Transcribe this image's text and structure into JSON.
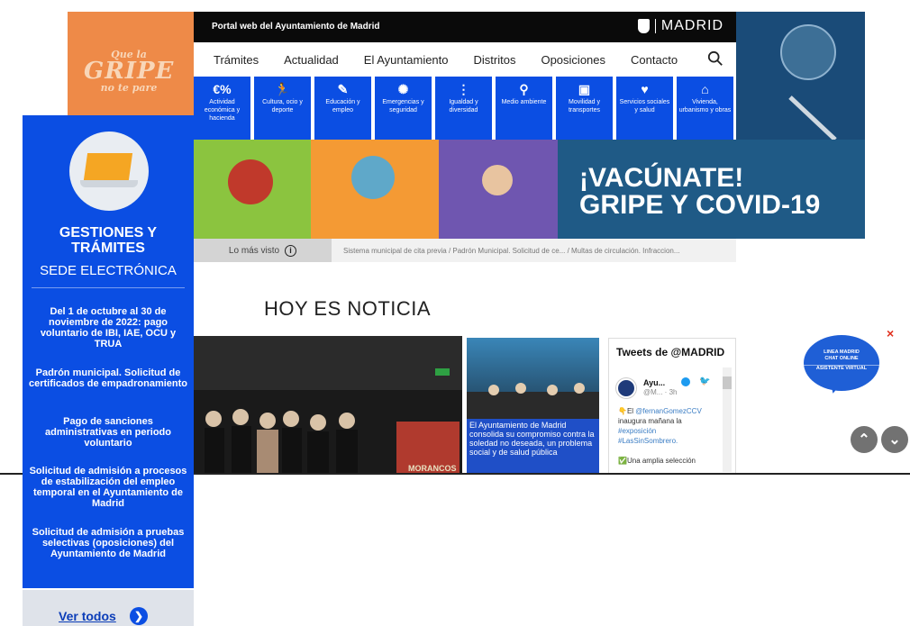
{
  "header": {
    "portal_label": "Portal web del Ayuntamiento de Madrid",
    "logo_text": "MADRID"
  },
  "nav": {
    "items": [
      "Trámites",
      "Actualidad",
      "El Ayuntamiento",
      "Distritos",
      "Oposiciones",
      "Contacto"
    ],
    "search_icon": "search-icon"
  },
  "categories": [
    {
      "icon": "€%",
      "label": "Actividad económica y hacienda"
    },
    {
      "icon": "🏃",
      "label": "Cultura, ocio y deporte"
    },
    {
      "icon": "✎",
      "label": "Educación y empleo"
    },
    {
      "icon": "✺",
      "label": "Emergencias y seguridad"
    },
    {
      "icon": "⋮",
      "label": "Igualdad y diversidad"
    },
    {
      "icon": "⚲",
      "label": "Medio ambiente"
    },
    {
      "icon": "▣",
      "label": "Movilidad y transportes"
    },
    {
      "icon": "♥",
      "label": "Servicios sociales y salud"
    },
    {
      "icon": "⌂",
      "label": "Vivienda, urbanismo y obras"
    }
  ],
  "campaign": {
    "gripe_top": "Que la",
    "gripe_big": "GRIPE",
    "gripe_bottom": "no te pare",
    "vacunate_l1": "¡VACÚNATE!",
    "vacunate_l2": "GRIPE Y COVID-19"
  },
  "mas_visto": {
    "label": "Lo más visto",
    "links": "Sistema municipal de cita previa  /  Padrón Municipal. Solicitud de ce...  /  Multas de circulación. Infraccion..."
  },
  "news": {
    "section_title": "HOY ES NOTICIA",
    "card2_caption": "El Ayuntamiento de Madrid consolida su compromiso contra la soledad no deseada, un problema social y de salud pública",
    "card1_watermark": "MORANCOS"
  },
  "tweets": {
    "title": "Tweets de @MADRID",
    "name": "Ayu...",
    "handle": "@M... · 3h",
    "line1_prefix": "👇El ",
    "line1_link": "@fernanGomezCCV",
    "line2": "inaugura mañana la",
    "line3": "#exposición",
    "line4": "#LasSinSombrero.",
    "line5": "✅Una amplia selección"
  },
  "widgets": {
    "close": "×",
    "bubble_l1": "LINEA MADRID",
    "bubble_l2": "CHAT ONLINE",
    "bubble_l3": "ASISTENTE VIRTUAL",
    "up": "⌃",
    "down": "⌄"
  },
  "sidebar": {
    "title": "GESTIONES Y TRÁMITES",
    "subtitle": "SEDE ELECTRÓNICA",
    "items": [
      "Del 1 de octubre al 30 de noviembre de 2022: pago voluntario de IBI, IAE, OCU y TRUA",
      "Padrón municipal. Solicitud de certificados de empadronamiento",
      "Pago de sanciones administrativas en periodo voluntario",
      "Solicitud de admisión a procesos de estabilización del empleo temporal en el Ayuntamiento de Madrid",
      "Solicitud de admisión a pruebas selectivas (oposiciones) del Ayuntamiento de Madrid"
    ],
    "ver_todos": "Ver todos",
    "ver_todos_arrow": "❯"
  },
  "colors": {
    "brand_blue": "#0b4ee3",
    "top_bar": "#0a0a0a",
    "close_red": "#e0301e"
  }
}
